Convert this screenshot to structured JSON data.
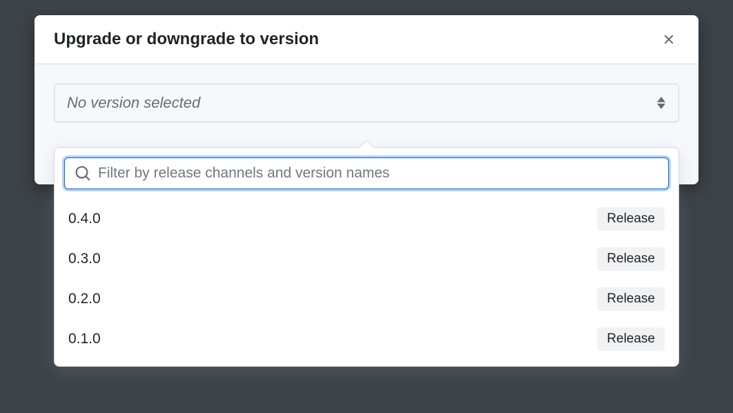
{
  "modal": {
    "title": "Upgrade or downgrade to version"
  },
  "select": {
    "placeholder_text": "No version selected"
  },
  "search": {
    "placeholder": "Filter by release channels and version names"
  },
  "options": [
    {
      "version": "0.4.0",
      "channel": "Release"
    },
    {
      "version": "0.3.0",
      "channel": "Release"
    },
    {
      "version": "0.2.0",
      "channel": "Release"
    },
    {
      "version": "0.1.0",
      "channel": "Release"
    }
  ]
}
